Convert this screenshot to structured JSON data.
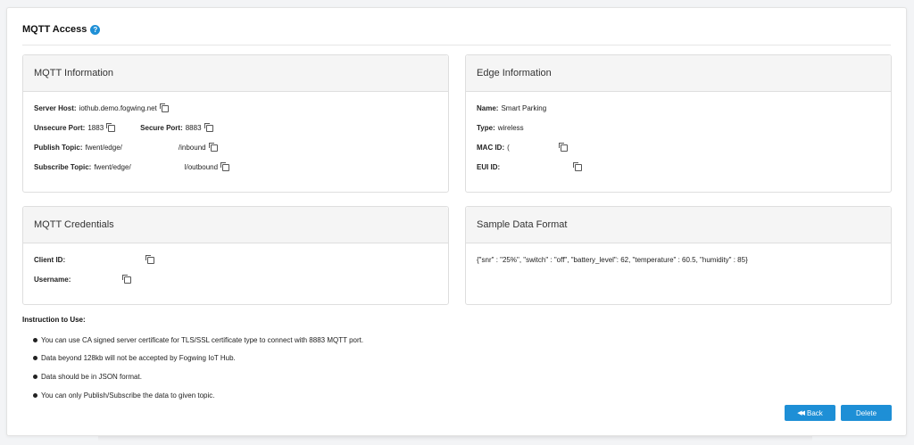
{
  "page": {
    "title": "MQTT Access",
    "help_glyph": "?"
  },
  "mqtt_info": {
    "heading": "MQTT Information",
    "server_host_label": "Server Host:",
    "server_host_value": "iothub.demo.fogwing.net",
    "unsecure_port_label": "Unsecure Port:",
    "unsecure_port_value": "1883",
    "secure_port_label": "Secure Port:",
    "secure_port_value": "8883",
    "publish_topic_label": "Publish Topic:",
    "publish_topic_prefix": "fwent/edge/",
    "publish_topic_suffix": "/inbound",
    "subscribe_topic_label": "Subscribe Topic:",
    "subscribe_topic_prefix": "fwent/edge/",
    "subscribe_topic_suffix": "l/outbound"
  },
  "edge_info": {
    "heading": "Edge Information",
    "name_label": "Name:",
    "name_value": "Smart Parking",
    "type_label": "Type:",
    "type_value": "wireless",
    "mac_label": "MAC ID:",
    "mac_value": "(",
    "eui_label": "EUI ID:"
  },
  "credentials": {
    "heading": "MQTT Credentials",
    "client_id_label": "Client ID:",
    "username_label": "Username:"
  },
  "sample": {
    "heading": "Sample Data Format",
    "payload": "{\"snr\" : \"25%\", \"switch\" : \"off\", \"battery_level\": 62, \"temperature\" : 60.5, \"humidity\" : 85}"
  },
  "instructions": {
    "title": "Instruction to Use:",
    "items": [
      "You can use CA signed server certificate for TLS/SSL certificate type to connect with 8883 MQTT port.",
      "Data beyond 128kb will not be accepted by Fogwing IoT Hub.",
      "Data should be in JSON format.",
      "You can only Publish/Subscribe the data to given topic."
    ]
  },
  "actions": {
    "back_label": "Back",
    "delete_label": "Delete"
  },
  "icons": {
    "help": "help-circle-icon",
    "copy": "copy-icon",
    "bullet": "bullet-dot-icon",
    "back": "rewind-icon"
  },
  "colors": {
    "accent": "#1e8fd6",
    "panel_header": "#f5f5f5",
    "border": "#dedede"
  }
}
